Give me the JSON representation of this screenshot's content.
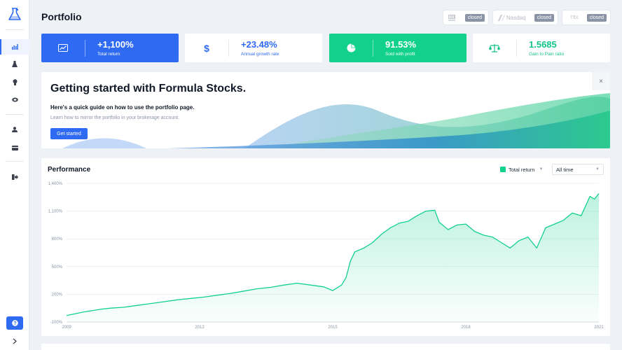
{
  "header": {
    "title": "Portfolio"
  },
  "markets": [
    {
      "name": "",
      "status": "closed",
      "icon": "nyse-logo-icon"
    },
    {
      "name": "Nasdaq",
      "status": "closed",
      "icon": "nasdaq-logo-icon"
    },
    {
      "name": "TSX",
      "status": "closed",
      "icon": "tsx-logo-icon"
    }
  ],
  "stats": [
    {
      "value": "+1,100%",
      "label": "Total return",
      "icon": "trend-chart-icon",
      "color": "#2e6bf2"
    },
    {
      "value": "+23.48%",
      "label": "Annual growth rate",
      "icon": "dollar-icon",
      "color": "#2e6bf2"
    },
    {
      "value": "91.53%",
      "label": "Sold with profit",
      "icon": "pie-chart-icon",
      "color": "#11d18c"
    },
    {
      "value": "1.5685",
      "label": "Gain to Pain ratio",
      "icon": "balance-scale-icon",
      "color": "#14c48a"
    }
  ],
  "banner": {
    "title": "Getting started with Formula Stocks.",
    "subtitle": "Here's a quick guide on how to use the portfolio page.",
    "description": "Learn how to mirror the portfolio in your brokerage account.",
    "button_label": "Get started",
    "close_label": "×"
  },
  "performance": {
    "title": "Performance",
    "legend_label": "Total return",
    "legend_color": "#11d18c",
    "range_label": "All time"
  },
  "sidebar": {
    "icons": [
      "logo-flask-icon",
      "bar-chart-icon",
      "flask-icon",
      "lightbulb-icon",
      "graduation-icon",
      "user-icon",
      "card-icon",
      "logout-icon",
      "help-icon",
      "chevron-right-icon"
    ],
    "help_label": "?",
    "expand_label": ">"
  },
  "chart_data": {
    "type": "area",
    "title": "Performance",
    "xlabel": "",
    "ylabel": "",
    "ylim": [
      -100,
      1400
    ],
    "yticks": [
      "-100%",
      "200%",
      "500%",
      "800%",
      "1,100%",
      "1,400%"
    ],
    "ytick_values": [
      -100,
      200,
      500,
      800,
      1100,
      1400
    ],
    "xticks": [
      "2009",
      "2012",
      "2015",
      "2018",
      "2021"
    ],
    "xtick_values": [
      2009,
      2012,
      2015,
      2018,
      2021
    ],
    "xlim": [
      2009,
      2021
    ],
    "grid": true,
    "series": [
      {
        "name": "Total return",
        "color": "#11d18c",
        "x": [
          2009.0,
          2009.2,
          2009.4,
          2009.6,
          2009.8,
          2010.0,
          2010.3,
          2010.6,
          2010.9,
          2011.2,
          2011.5,
          2011.8,
          2012.1,
          2012.4,
          2012.7,
          2013.0,
          2013.3,
          2013.6,
          2013.9,
          2014.2,
          2014.5,
          2014.8,
          2014.9,
          2015.0,
          2015.2,
          2015.3,
          2015.4,
          2015.5,
          2015.7,
          2015.9,
          2016.1,
          2016.3,
          2016.5,
          2016.7,
          2016.9,
          2017.1,
          2017.3,
          2017.4,
          2017.6,
          2017.8,
          2018.0,
          2018.2,
          2018.4,
          2018.6,
          2018.8,
          2019.0,
          2019.2,
          2019.4,
          2019.6,
          2019.8,
          2020.0,
          2020.2,
          2020.4,
          2020.6,
          2020.8,
          2020.9,
          2021.0
        ],
        "values": [
          -30,
          -10,
          10,
          25,
          40,
          50,
          60,
          80,
          100,
          120,
          140,
          155,
          170,
          190,
          210,
          235,
          260,
          275,
          300,
          320,
          300,
          280,
          260,
          240,
          300,
          380,
          560,
          660,
          700,
          760,
          850,
          920,
          970,
          990,
          1050,
          1100,
          1110,
          980,
          900,
          950,
          960,
          880,
          840,
          820,
          760,
          700,
          780,
          820,
          700,
          920,
          960,
          1000,
          1080,
          1050,
          1260,
          1230,
          1290
        ]
      }
    ]
  }
}
